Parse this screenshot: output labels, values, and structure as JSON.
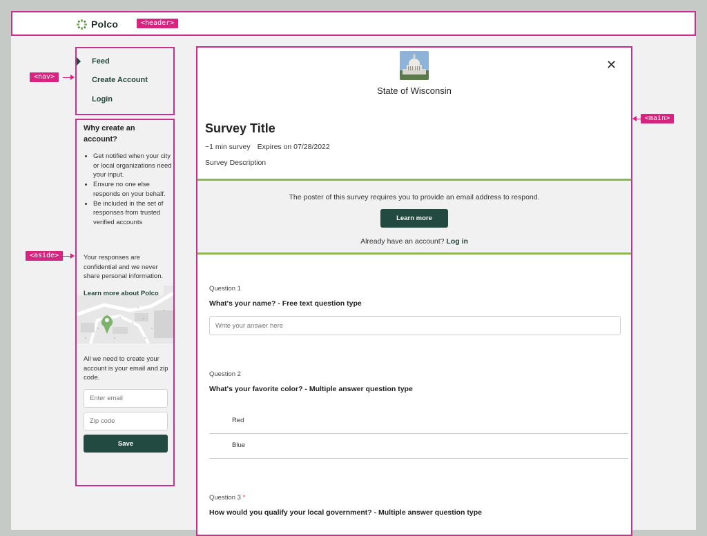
{
  "annotations": {
    "header_tag": "<header>",
    "nav_tag": "<nav>",
    "aside_tag": "<aside>",
    "main_tag": "<main>"
  },
  "colors": {
    "outline": "#cc2e8b",
    "tag": "#d6257e",
    "brand_dark_green": "#234a40",
    "accent_green": "#8eb553",
    "background": "#f1f1f1"
  },
  "header": {
    "logo_icon": "polco-logo-icon",
    "logo_text": "Polco"
  },
  "nav": {
    "items": [
      {
        "label": "Feed",
        "active": true
      },
      {
        "label": "Create Account"
      },
      {
        "label": "Login"
      }
    ]
  },
  "aside": {
    "title": "Why create an account?",
    "bullets": [
      "Get notified when your city or local organizations need your input.",
      "Ensure no one else responds on your behalf.",
      "Be included in the set of responses from trusted verified accounts"
    ],
    "privacy_text": "Your responses are confidential and we never share personal information.",
    "learn_more_link": "Learn more about Polco",
    "map_icon": "map-pin-illustration",
    "signup_text": "All we need to create your account is your email and zip code.",
    "email_placeholder": "Enter email",
    "zip_placeholder": "Zip code",
    "save_label": "Save"
  },
  "main": {
    "org_image": "capitol-building-image",
    "org_name": "State of Wisconsin",
    "close_icon": "close-icon",
    "close_glyph": "✕",
    "survey_title": "Survey Title",
    "duration": "~1 min survey",
    "expires": "Expires on 07/28/2022",
    "description": "Survey Description",
    "notice": {
      "text": "The poster of this survey requires you to provide an email address to respond.",
      "button_label": "Learn more",
      "login_prompt": "Already have an account?",
      "login_link": "Log in"
    },
    "questions": [
      {
        "label": "Question 1",
        "title": "What's your name? - Free text question type",
        "placeholder": "Write your answer here"
      },
      {
        "label": "Question 2",
        "title": "What's your favorite color? - Multiple answer question type",
        "options": [
          "Red",
          "Blue"
        ]
      },
      {
        "label": "Question 3",
        "required_marker": "*",
        "title": "How would you qualify your local government? - Multiple answer question type"
      }
    ]
  }
}
